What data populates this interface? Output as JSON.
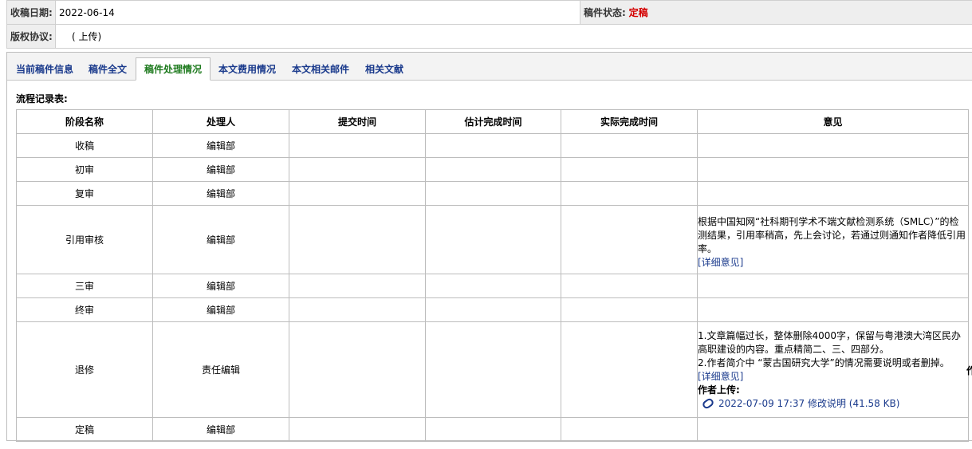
{
  "info": {
    "received_label": "收稿日期:",
    "received_value": "2022-06-14",
    "status_label": "稿件状态:",
    "status_value": "定稿",
    "copyright_label": "版权协议:",
    "copyright_value": "( 上传)"
  },
  "tabs": [
    {
      "label": "当前稿件信息"
    },
    {
      "label": "稿件全文"
    },
    {
      "label": "稿件处理情况",
      "active": true
    },
    {
      "label": "本文费用情况"
    },
    {
      "label": "本文相关邮件"
    },
    {
      "label": "相关文献"
    }
  ],
  "flow": {
    "title": "流程记录表:",
    "headers": [
      "阶段名称",
      "处理人",
      "提交时间",
      "估计完成时间",
      "实际完成时间",
      "意见"
    ],
    "rows": [
      {
        "stage": "收稿",
        "handler": "编辑部"
      },
      {
        "stage": "初审",
        "handler": "编辑部"
      },
      {
        "stage": "复审",
        "handler": "编辑部"
      },
      {
        "stage": "引用审核",
        "handler": "编辑部",
        "opinion": "根据中国知网“社科期刊学术不端文献检测系统（SMLC）”的检测结果，引用率稍高，先上会讨论，若通过则通知作者降低引用率。",
        "detail_link": "[详细意见]"
      },
      {
        "stage": "三审",
        "handler": "编辑部"
      },
      {
        "stage": "终审",
        "handler": "编辑部"
      },
      {
        "stage": "退修",
        "handler": "责任编辑",
        "opinion_1": "1.文章篇幅过长，整体删除4000字，保留与粤港澳大湾区民办高职建设的内容。重点精简二、三、四部分。",
        "opinion_2": "2.作者简介中 “蒙古国研究大学”的情况需要说明或者删掉。",
        "detail_link": "[详细意见]",
        "author_upload_label": "作者上传:",
        "attachment": "2022-07-09 17:37 修改说明 (41.58 KB)",
        "overflow_char": "作"
      },
      {
        "stage": "定稿",
        "handler": "编辑部"
      }
    ]
  },
  "colors": {
    "link": "#1a3a8c",
    "active_tab": "#1e7a1e",
    "status": "#d40000"
  }
}
